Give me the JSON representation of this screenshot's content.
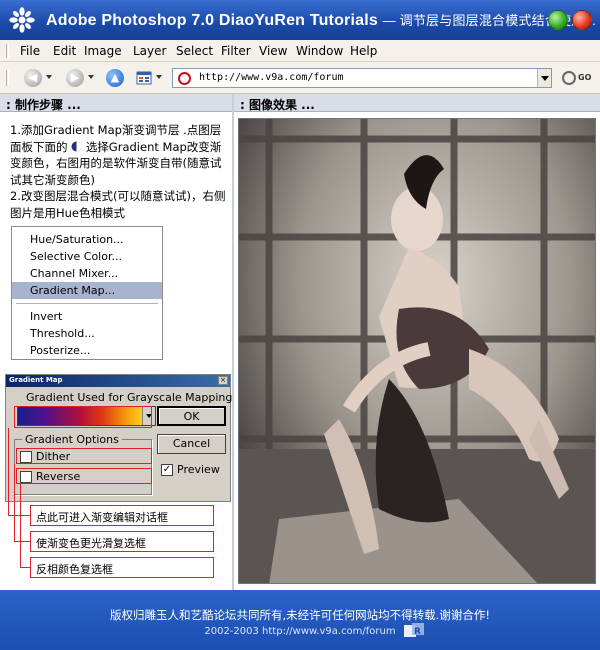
{
  "window": {
    "title": "Adobe Photoshop 7.0  DiaoYuRen Tutorials",
    "subtitle": "— 调节层与图层混合模式结合使用..."
  },
  "menubar": {
    "items": [
      "File",
      "Edit",
      "Image",
      "Layer",
      "Select",
      "Filter",
      "View",
      "Window",
      "Help"
    ]
  },
  "toolbar": {
    "url": "http://www.v9a.com/forum",
    "go_label": "GO"
  },
  "left_panel": {
    "header": ": 制作步骤 ...",
    "steps": [
      "1.添加Gradient Map渐变调节层 .点图层面板下面的",
      "选择Gradient Map改变渐变颜色，右图用的是软件渐变自带(随意试试其它渐变颜色)",
      "2.改变图层混合模式(可以随意试试)，右侧图片是用Hue色相模式"
    ],
    "adjust_menu": [
      "Hue/Saturation...",
      "Selective Color...",
      "Channel Mixer...",
      "Gradient Map...",
      "Invert",
      "Threshold...",
      "Posterize..."
    ],
    "selected_item": "Gradient Map..."
  },
  "dialog": {
    "title": "Gradient Map",
    "gradient_label": "Gradient Used for Grayscale Mapping",
    "ok": "OK",
    "cancel": "Cancel",
    "options_label": "Gradient Options",
    "dither": "Dither",
    "reverse": "Reverse",
    "preview": "Preview",
    "preview_checked": true,
    "dither_checked": false,
    "reverse_checked": false
  },
  "callouts": [
    "点此可进入渐变编辑对话框",
    "使渐变色更光滑复选框",
    "反相颜色复选框"
  ],
  "right_panel": {
    "header": ": 图像效果 ..."
  },
  "footer": {
    "line1": "版权归雕玉人和艺酷论坛共同所有,未经许可任何网站均不得转载.谢谢合作!",
    "line2": "2002-2003 http://www.v9a.com/forum"
  },
  "colors": {
    "title_bg": "#1a49a8",
    "footer_bg": "#1b4fb0",
    "callout_red": "#e0202a",
    "selected_item_bg": "#a8b4cd"
  }
}
